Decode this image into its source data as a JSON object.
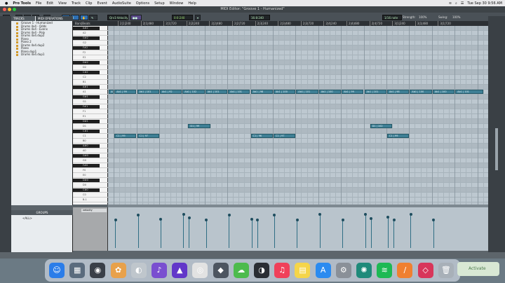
{
  "menubar": {
    "app": "Pro Tools",
    "items": [
      "File",
      "Edit",
      "View",
      "Track",
      "Clip",
      "Event",
      "AudioSuite",
      "Options",
      "Setup",
      "Window",
      "Help"
    ],
    "clock": "Tue Sep 30  9:56 AM"
  },
  "window": {
    "title": "MIDI Editor: \"Groove 1 - Humanized\""
  },
  "toolbar": {
    "instrument": "Qrv1-Velocity",
    "nudge": "16:8:240",
    "grid_value": "1/16 note",
    "strength_label": "Strength:",
    "strength_value": "100%",
    "swing_label": "Swing:",
    "swing_value": "100%",
    "field2": "0:0:240"
  },
  "left": {
    "tracks_tab": "TRACKS",
    "midi_tab": "MIDI OPERATIONS",
    "tracks": [
      "Groove 1 - Humanized",
      "Drums 4x4 - Odds",
      "Drums 4x4 - Evens",
      "Drums 4x4 - Poly",
      "Drums 4x4.dup2",
      "Piano",
      "Piano 2",
      "Drums 4x4.dup2",
      "Piano",
      "Piano.dup1",
      "Drums 4x4.dup1"
    ],
    "groups_label": "GROUPS",
    "groups_item": "<ALL>"
  },
  "ruler": {
    "header": "Bars|Beats",
    "ticks": [
      "2|1|240",
      "2|1|480",
      "2|1|720",
      "2|2|240",
      "2|2|480",
      "2|2|720",
      "2|3|240",
      "2|3|480",
      "2|3|720",
      "2|4|240",
      "2|4|480",
      "2|4|720",
      "3|1|240",
      "3|1|480",
      "3|1|720"
    ]
  },
  "piano_keys": [
    "A#2",
    "A2",
    "G#2",
    "G2",
    "F#2",
    "F2",
    "E2",
    "D#2",
    "D2",
    "C#2",
    "C2",
    "B1",
    "A#1",
    "A1",
    "G#1",
    "G1",
    "F#1",
    "F1",
    "E1",
    "D#1",
    "D1",
    "C#1",
    "C1",
    "B0",
    "A#0",
    "A0",
    "G#0",
    "G0",
    "F#0",
    "F0",
    "E0",
    "D#0",
    "D0",
    "C#0",
    "C0",
    "B-1"
  ],
  "notes": [
    {
      "label": "Ab1 | 98",
      "row": 13,
      "start": 0,
      "len": 1
    },
    {
      "label": "Ab1 | 99",
      "row": 13,
      "start": 1,
      "len": 4
    },
    {
      "label": "Ab1 | 101",
      "row": 13,
      "start": 5,
      "len": 4
    },
    {
      "label": "Ab1 | 92",
      "row": 13,
      "start": 9,
      "len": 4
    },
    {
      "label": "Ab1 | 102",
      "row": 13,
      "start": 13,
      "len": 4
    },
    {
      "label": "Ab1 | 101",
      "row": 13,
      "start": 17,
      "len": 4
    },
    {
      "label": "Ab1 | 101",
      "row": 13,
      "start": 21,
      "len": 4
    },
    {
      "label": "Ab1 | 98",
      "row": 13,
      "start": 25,
      "len": 4
    },
    {
      "label": "Ab1 | 100",
      "row": 13,
      "start": 29,
      "len": 4
    },
    {
      "label": "Ab1 | 101",
      "row": 13,
      "start": 33,
      "len": 4
    },
    {
      "label": "Ab1 | 100",
      "row": 13,
      "start": 37,
      "len": 4
    },
    {
      "label": "Ab1 | 99",
      "row": 13,
      "start": 41,
      "len": 4
    },
    {
      "label": "Ab1 | 101",
      "row": 13,
      "start": 45,
      "len": 4
    },
    {
      "label": "Ab1 | 98",
      "row": 13,
      "start": 49,
      "len": 4
    },
    {
      "label": "Ab1 | 100",
      "row": 13,
      "start": 53,
      "len": 4
    },
    {
      "label": "Ab1 | 100",
      "row": 13,
      "start": 57,
      "len": 4
    },
    {
      "label": "Ab1 | 101",
      "row": 13,
      "start": 61,
      "len": 5
    },
    {
      "label": "D1 | 99",
      "row": 20,
      "start": 14,
      "len": 4
    },
    {
      "label": "D1 | 102",
      "row": 20,
      "start": 46,
      "len": 4
    },
    {
      "label": "C1 | 99",
      "row": 22,
      "start": 1,
      "len": 4
    },
    {
      "label": "C1 | 97",
      "row": 22,
      "start": 5,
      "len": 4
    },
    {
      "label": "C1 | 96",
      "row": 22,
      "start": 25,
      "len": 4
    },
    {
      "label": "C1 | 97",
      "row": 22,
      "start": 29,
      "len": 4
    },
    {
      "label": "C1 | 99",
      "row": 22,
      "start": 49,
      "len": 4
    }
  ],
  "velocity": {
    "label": "velocity",
    "values": [
      {
        "pos": 1,
        "v": 98
      },
      {
        "pos": 5,
        "v": 116
      },
      {
        "pos": 9,
        "v": 99
      },
      {
        "pos": 13,
        "v": 117
      },
      {
        "pos": 14,
        "v": 104
      },
      {
        "pos": 17,
        "v": 97
      },
      {
        "pos": 21,
        "v": 116
      },
      {
        "pos": 25,
        "v": 99
      },
      {
        "pos": 26,
        "v": 98
      },
      {
        "pos": 29,
        "v": 116
      },
      {
        "pos": 33,
        "v": 98
      },
      {
        "pos": 37,
        "v": 117
      },
      {
        "pos": 41,
        "v": 97
      },
      {
        "pos": 45,
        "v": 117
      },
      {
        "pos": 46,
        "v": 103
      },
      {
        "pos": 49,
        "v": 108
      },
      {
        "pos": 50,
        "v": 98
      },
      {
        "pos": 53,
        "v": 117
      },
      {
        "pos": 57,
        "v": 97
      }
    ]
  },
  "activate": "Activate",
  "dock": [
    {
      "name": "finder-icon",
      "glyph": "☺",
      "color": "#2b7de9"
    },
    {
      "name": "launchpad-icon",
      "glyph": "▦",
      "color": "#5a6b7d"
    },
    {
      "name": "quicktime-icon",
      "glyph": "◉",
      "color": "#3a3f48"
    },
    {
      "name": "photos-icon",
      "glyph": "✿",
      "color": "#e8a14b"
    },
    {
      "name": "preview-icon",
      "glyph": "◐",
      "color": "#bfc6cc"
    },
    {
      "name": "podcast-icon",
      "glyph": "♪",
      "color": "#7a4fd0"
    },
    {
      "name": "avid-icon",
      "glyph": "▲",
      "color": "#6237c9"
    },
    {
      "name": "chrome-icon",
      "glyph": "◎",
      "color": "#e2e2e2"
    },
    {
      "name": "app-icon",
      "glyph": "◆",
      "color": "#4d5560"
    },
    {
      "name": "cloud-icon",
      "glyph": "☁",
      "color": "#4dbb4d"
    },
    {
      "name": "protools-icon",
      "glyph": "◑",
      "color": "#2a2d33"
    },
    {
      "name": "music-icon",
      "glyph": "♫",
      "color": "#f0405a"
    },
    {
      "name": "notes-icon",
      "glyph": "▤",
      "color": "#f5d54a"
    },
    {
      "name": "appstore-icon",
      "glyph": "A",
      "color": "#2b8bf0"
    },
    {
      "name": "settings-icon",
      "glyph": "⚙",
      "color": "#8a9098"
    },
    {
      "name": "plugin-icon",
      "glyph": "✺",
      "color": "#1f8a7a"
    },
    {
      "name": "spotify-icon",
      "glyph": "≋",
      "color": "#1db954"
    },
    {
      "name": "sublime-icon",
      "glyph": "∕",
      "color": "#f08030"
    },
    {
      "name": "unknown-icon",
      "glyph": "◇",
      "color": "#d8365a"
    },
    {
      "name": "trash-icon",
      "glyph": "🗑",
      "color": "#a8b0b8"
    }
  ]
}
